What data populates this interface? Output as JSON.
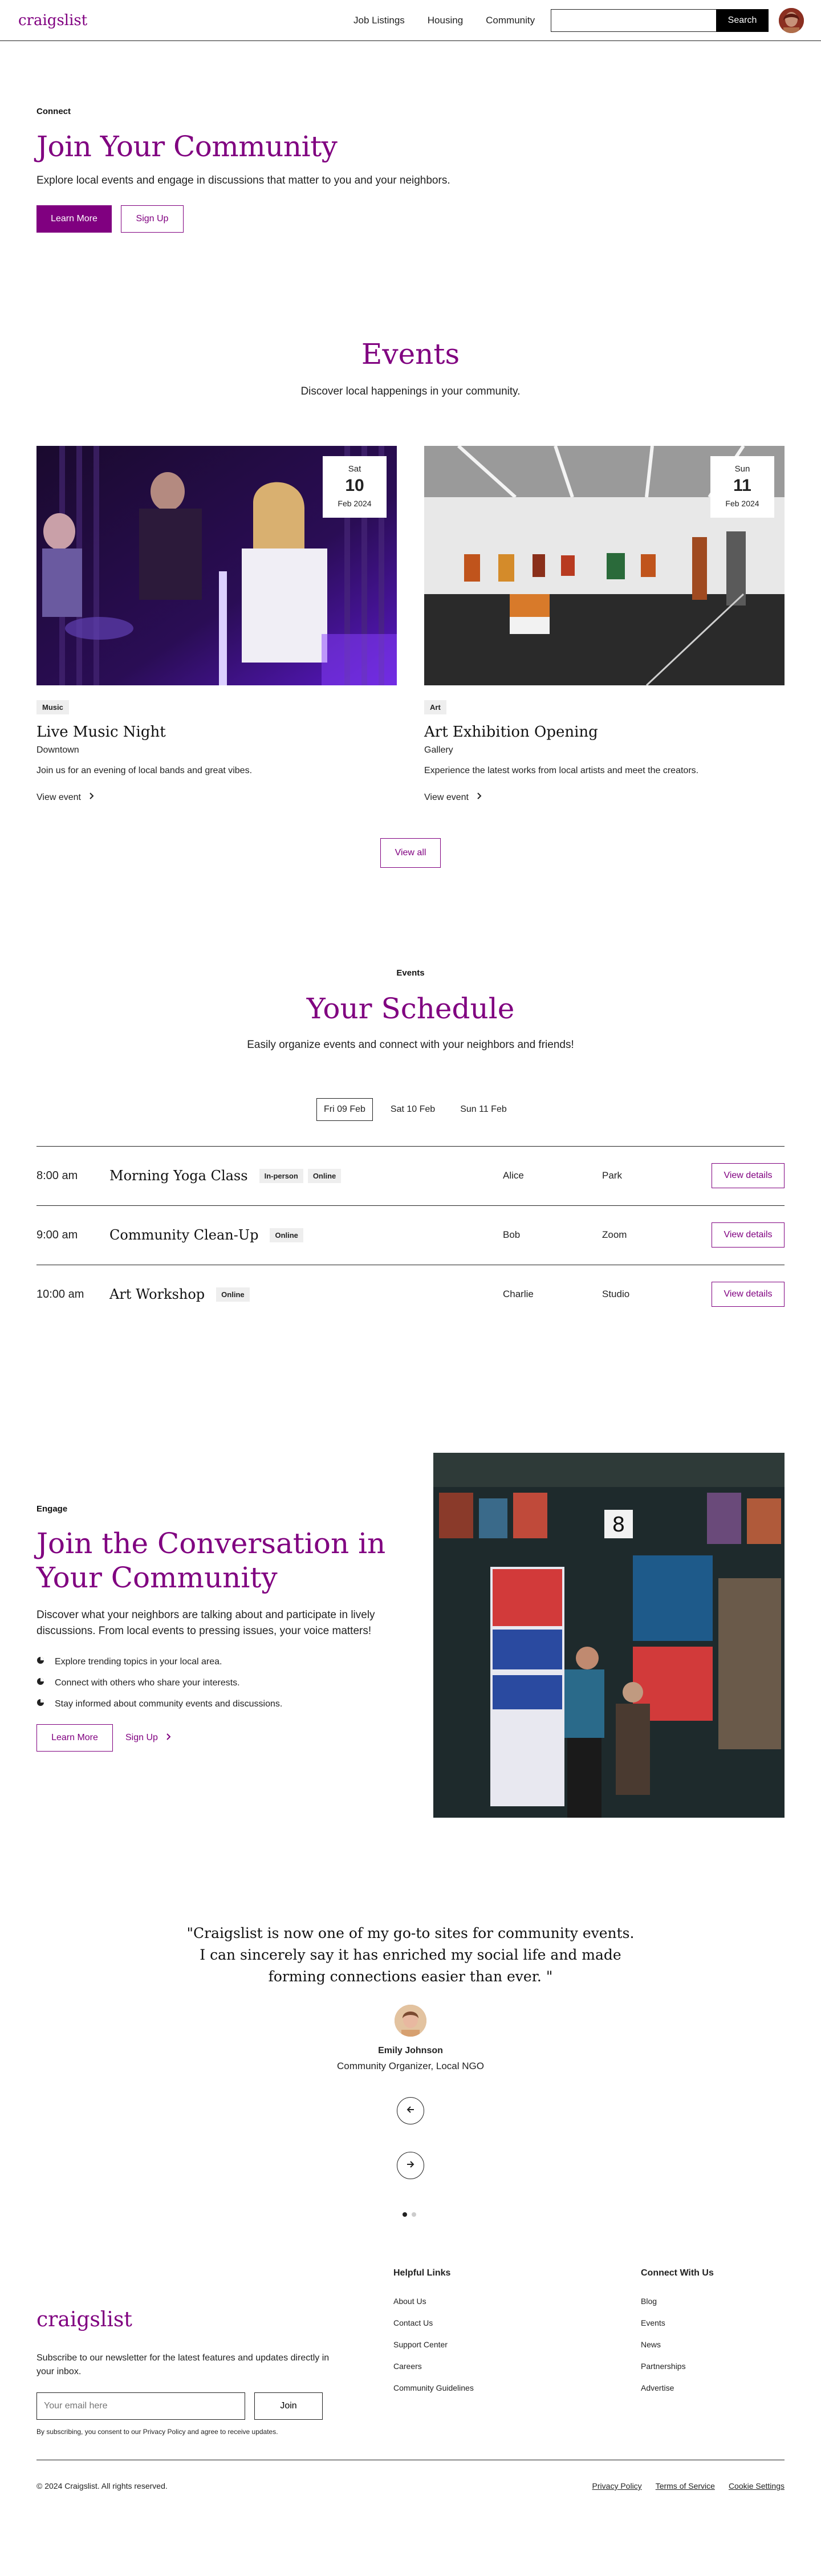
{
  "header": {
    "logo": "craigslist",
    "nav": [
      "Job Listings",
      "Housing",
      "Community"
    ],
    "search_placeholder": "",
    "search_button": "Search"
  },
  "hero": {
    "eyebrow": "Connect",
    "title": "Join Your Community",
    "subtitle": "Explore local events and engage in discussions that matter to you and your neighbors.",
    "primary_button": "Learn More",
    "secondary_button": "Sign Up"
  },
  "events": {
    "title": "Events",
    "subtitle": "Discover local happenings in your community.",
    "cards": [
      {
        "dow": "Sat",
        "day": "10",
        "month": "Feb 2024",
        "tag": "Music",
        "title": "Live Music Night",
        "location": "Downtown",
        "description": "Join us for an evening of local bands and great vibes.",
        "link": "View event"
      },
      {
        "dow": "Sun",
        "day": "11",
        "month": "Feb 2024",
        "tag": "Art",
        "title": "Art Exhibition Opening",
        "location": "Gallery",
        "description": "Experience the latest works from local artists and meet the creators.",
        "link": "View event"
      }
    ],
    "view_all": "View all"
  },
  "schedule": {
    "eyebrow": "Events",
    "title": "Your Schedule",
    "subtitle": "Easily organize events and connect with your neighbors and friends!",
    "tabs": [
      "Fri 09 Feb",
      "Sat 10 Feb",
      "Sun 11 Feb"
    ],
    "active_tab": "Fri 09 Feb",
    "rows": [
      {
        "time": "8:00 am",
        "title": "Morning Yoga Class",
        "tags": [
          "In-person",
          "Online"
        ],
        "host": "Alice",
        "place": "Park",
        "button": "View details"
      },
      {
        "time": "9:00 am",
        "title": "Community Clean-Up",
        "tags": [
          "Online"
        ],
        "host": "Bob",
        "place": "Zoom",
        "button": "View details"
      },
      {
        "time": "10:00 am",
        "title": "Art Workshop",
        "tags": [
          "Online"
        ],
        "host": "Charlie",
        "place": "Studio",
        "button": "View details"
      }
    ]
  },
  "conversation": {
    "eyebrow": "Engage",
    "title": "Join the Conversation in Your Community",
    "text": "Discover what your neighbors are talking about and participate in lively discussions. From local events to pressing issues, your voice matters!",
    "bullets": [
      "Explore trending topics in your local area.",
      "Connect with others who share your interests.",
      "Stay informed about community events and discussions."
    ],
    "primary_button": "Learn More",
    "secondary_link": "Sign Up"
  },
  "testimonial": {
    "quote": "\"Craigslist is now one of my go-to sites for community events. I can sincerely say it has enriched my social life and made forming connections easier than ever. \"",
    "name": "Emily Johnson",
    "role": "Community Organizer, Local NGO",
    "slides": 2,
    "active_slide": 1
  },
  "footer": {
    "logo": "craigslist",
    "newsletter_text": "Subscribe to our newsletter for the latest features and updates directly in your inbox.",
    "email_placeholder": "Your email here",
    "join_button": "Join",
    "fine_print": "By subscribing, you consent to our Privacy Policy and agree to receive updates.",
    "helpful_title": "Helpful Links",
    "helpful_links": [
      "About Us",
      "Contact Us",
      "Support Center",
      "Careers",
      "Community Guidelines"
    ],
    "connect_title": "Connect With Us",
    "connect_links": [
      "Blog",
      "Events",
      "News",
      "Partnerships",
      "Advertise"
    ],
    "copyright": "© 2024 Craigslist. All rights reserved.",
    "legal": [
      "Privacy Policy",
      "Terms of Service",
      "Cookie Settings"
    ]
  },
  "colors": {
    "brand": "#800080",
    "text": "#222222",
    "tag_bg": "#eeeeee"
  }
}
